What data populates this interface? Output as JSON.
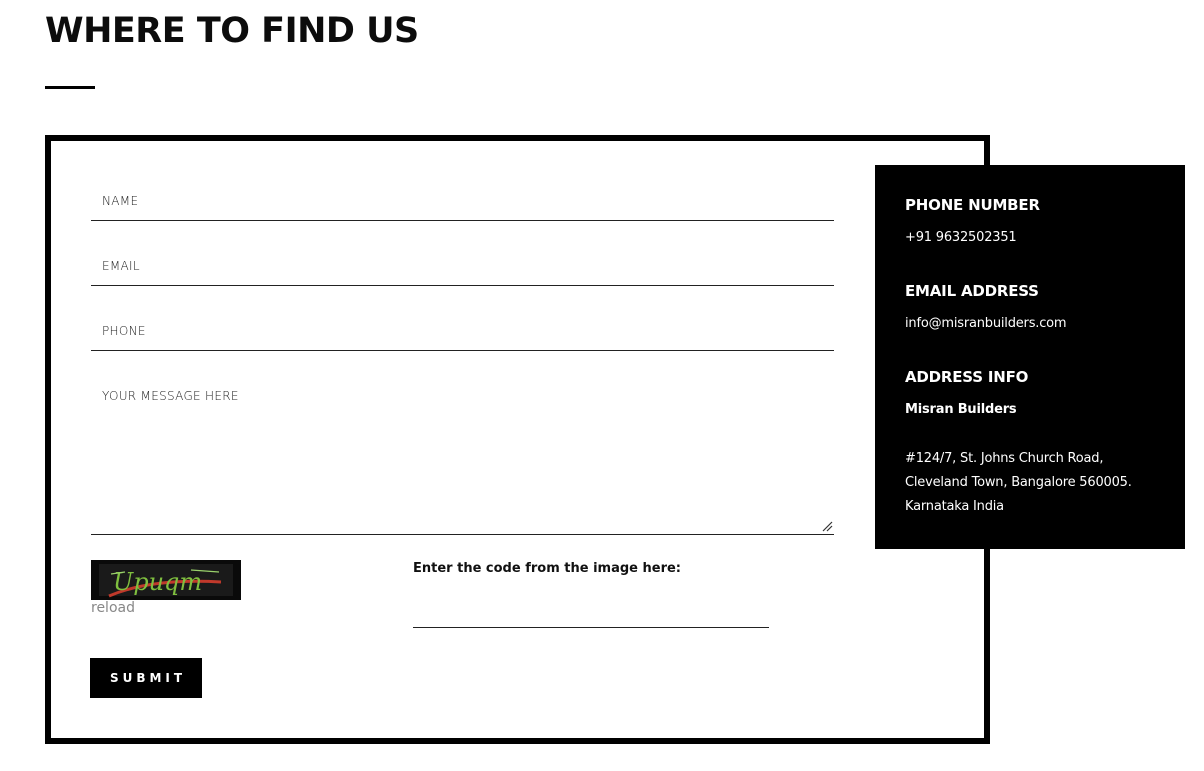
{
  "header": {
    "title": "WHERE TO FIND US"
  },
  "form": {
    "name_placeholder": "NAME",
    "email_placeholder": "EMAIL",
    "phone_placeholder": "PHONE",
    "message_placeholder": "YOUR MESSAGE HERE",
    "captcha_text": "Upuqm",
    "reload_label": "reload",
    "captcha_prompt": "Enter the code from the image here:",
    "submit_label": "SUBMIT"
  },
  "contact": {
    "phone_heading": "PHONE NUMBER",
    "phone_value": "+91 9632502351",
    "email_heading": "EMAIL ADDRESS",
    "email_value": "info@misranbuilders.com",
    "address_heading": "ADDRESS INFO",
    "company_name": "Misran Builders",
    "address_line1": "#124/7, St. Johns Church Road,",
    "address_line2": "Cleveland Town, Bangalore 560005.",
    "address_line3": "Karnataka India"
  },
  "colors": {
    "accent": "#000000",
    "background": "#ffffff",
    "captcha_text": "#7fbf3f",
    "captcha_strike": "#c0392b"
  }
}
